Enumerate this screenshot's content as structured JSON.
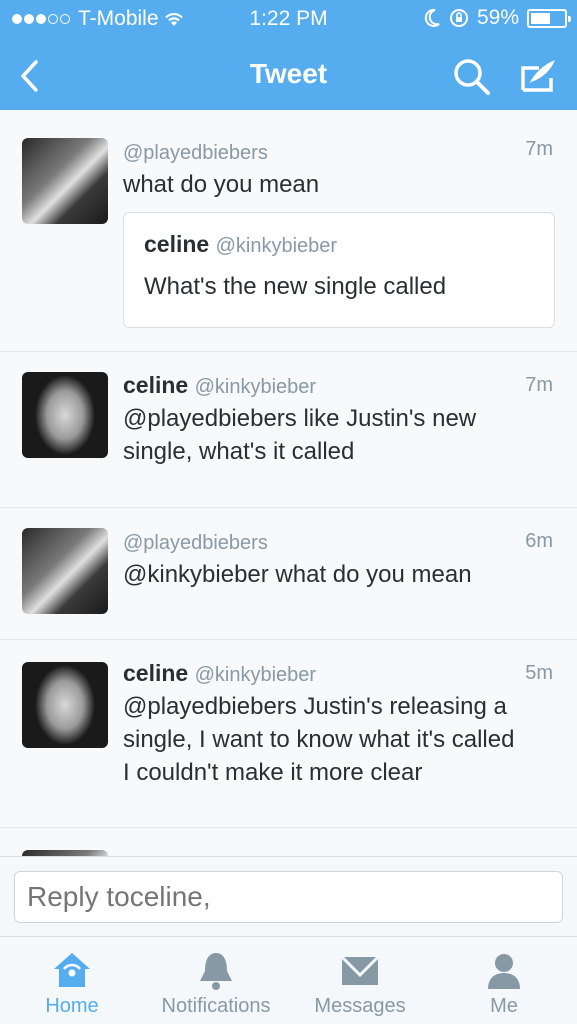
{
  "status": {
    "carrier": "T-Mobile",
    "time": "1:22 PM",
    "battery": "59%",
    "battery_level": 0.59
  },
  "nav": {
    "title": "Tweet"
  },
  "tweets": [
    {
      "handle": "@playedbiebers",
      "time": "7m",
      "text": "what do you mean",
      "quote": {
        "name": "celine",
        "handle": "@kinkybieber",
        "text": "What's the new single called"
      }
    },
    {
      "name": "celine",
      "handle": "@kinkybieber",
      "time": "7m",
      "text_line1": "@playedbiebers like Justin's new",
      "text_line2": "single, what's it called"
    },
    {
      "handle": "@playedbiebers",
      "time": "6m",
      "text": "@kinkybieber what do you mean"
    },
    {
      "name": "celine",
      "handle": "@kinkybieber",
      "time": "5m",
      "text_line1": "@playedbiebers Justin's releasing a",
      "text_line2": "single, I want to know what it's called",
      "text_line3": "I couldn't make it more clear"
    }
  ],
  "reply": {
    "placeholder": "Reply toceline,"
  },
  "tabs": [
    {
      "label": "Home"
    },
    {
      "label": "Notifications"
    },
    {
      "label": "Messages"
    },
    {
      "label": "Me"
    }
  ],
  "colors": {
    "accent": "#55acee",
    "muted": "#8899a6"
  }
}
